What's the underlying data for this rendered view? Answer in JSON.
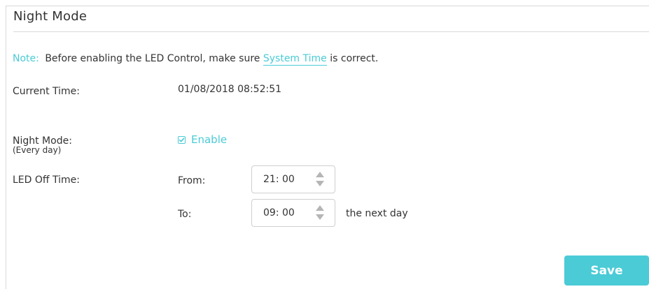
{
  "section": {
    "title": "Night Mode"
  },
  "note": {
    "label": "Note:",
    "text_before": "Before enabling the LED Control, make sure ",
    "link": "System Time",
    "text_after": " is correct."
  },
  "current_time": {
    "label": "Current Time:",
    "value": "01/08/2018 08:52:51"
  },
  "night_mode": {
    "label": "Night Mode:",
    "sublabel": "(Every day)",
    "checkbox_label": "Enable",
    "checked": true
  },
  "led_off_time": {
    "label": "LED Off Time:",
    "from_label": "From:",
    "from_value": "21: 00",
    "to_label": "To:",
    "to_value": "09: 00",
    "suffix": "the next day"
  },
  "actions": {
    "save_label": "Save"
  },
  "colors": {
    "accent": "#4acbd6",
    "text": "#333333",
    "divider": "#d9d9d9"
  },
  "icons": {
    "checkbox": "checkmark-icon",
    "spinner_up": "triangle-up-icon",
    "spinner_down": "triangle-down-icon"
  }
}
